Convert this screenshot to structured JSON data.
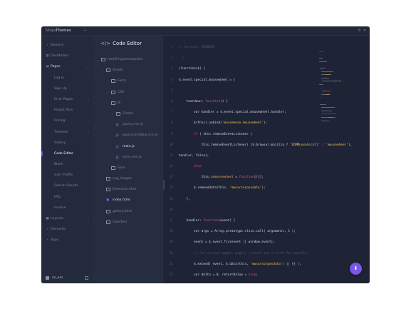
{
  "app": {
    "brand_left": "Ninja",
    "brand_right": "Themes"
  },
  "sidebar": {
    "items": [
      {
        "label": "General",
        "icon": "chevron-right-icon",
        "type": "section"
      },
      {
        "label": "Dashboard",
        "icon": "chart-icon",
        "chevron": "›"
      },
      {
        "label": "Pages",
        "icon": "document-icon",
        "chevron": "⌄",
        "bold": true
      },
      {
        "label": "Log In",
        "sub": true,
        "chevron": "›"
      },
      {
        "label": "Sign Up",
        "sub": true
      },
      {
        "label": "Error Pages",
        "sub": true,
        "chevron": "›"
      },
      {
        "label": "Forgot Pass",
        "sub": true
      },
      {
        "label": "Pricing",
        "sub": true,
        "chevron": "›"
      },
      {
        "label": "Timeline",
        "sub": true,
        "chevron": "›"
      },
      {
        "label": "Gallery",
        "sub": true
      },
      {
        "label": "Code Editor",
        "sub": true,
        "active": true
      },
      {
        "label": "Blank",
        "sub": true
      },
      {
        "label": "User Profile",
        "sub": true
      },
      {
        "label": "Search Results",
        "sub": true
      },
      {
        "label": "FAQ",
        "sub": true
      },
      {
        "label": "Invoice",
        "sub": true
      },
      {
        "label": "Layouts",
        "icon": "grid-icon",
        "chevron": "›"
      },
      {
        "label": "Elements",
        "icon": "chevron-right-icon",
        "type": "section"
      },
      {
        "label": "Apps",
        "icon": "chevron-right-icon",
        "type": "section"
      }
    ],
    "user": {
      "name": "an_ass"
    }
  },
  "explorer": {
    "title": "Code Editor",
    "tree": [
      {
        "name": "html5-hypertemplate",
        "depth": 0,
        "kind": "folder",
        "chev": "⌄"
      },
      {
        "name": "Assets",
        "depth": 1,
        "kind": "folder",
        "chev": "⌄"
      },
      {
        "name": "Fonts",
        "depth": 2,
        "kind": "folder",
        "chev": "›"
      },
      {
        "name": "CSS",
        "depth": 2,
        "kind": "folder",
        "chev": "›"
      },
      {
        "name": "JS",
        "depth": 2,
        "kind": "folder",
        "chev": "⌄"
      },
      {
        "name": "Charts",
        "depth": 3,
        "kind": "folder",
        "chev": "›"
      },
      {
        "name": "jquery.min.js",
        "depth": 3,
        "kind": "js"
      },
      {
        "name": "jquery.scrollbar.min.js",
        "depth": 3,
        "kind": "js"
      },
      {
        "name": "main.js",
        "depth": 3,
        "kind": "js",
        "active": true
      },
      {
        "name": "skins.min.js",
        "depth": 3,
        "kind": "js"
      },
      {
        "name": "Sass",
        "depth": 2,
        "kind": "folder",
        "chev": "›"
      },
      {
        "name": "svg_images",
        "depth": 1,
        "kind": "folder",
        "chev": "›"
      },
      {
        "name": "Elements.html",
        "depth": 1,
        "kind": "file"
      },
      {
        "name": "index.html",
        "depth": 1,
        "kind": "html",
        "active": true
      },
      {
        "name": "gallery.html",
        "depth": 1,
        "kind": "file"
      },
      {
        "name": "manifest",
        "depth": 1,
        "kind": "file"
      }
    ]
  },
  "editor": {
    "lines": [
      {
        "n": "1",
        "tokens": [
          {
            "t": "// Version: 3000006",
            "c": "comment"
          }
        ]
      },
      {
        "n": "2",
        "tokens": [
          {
            "t": "  \\",
            "c": "comment"
          }
        ]
      },
      {
        "n": "3",
        "tokens": [
          {
            "t": "(function($) {",
            "c": "plain"
          }
        ]
      },
      {
        "n": "4",
        "tokens": [
          {
            "t": "$.event.special.mousewheel = {",
            "c": "plain"
          }
        ]
      },
      {
        "n": "5",
        "tokens": [
          {
            "t": "",
            "c": "plain"
          }
        ]
      },
      {
        "n": "6",
        "tokens": [
          {
            "t": "    teardown: ",
            "c": "plain"
          },
          {
            "t": "function",
            "c": "kw"
          },
          {
            "t": "() {",
            "c": "plain"
          }
        ]
      },
      {
        "n": "7",
        "tokens": [
          {
            "t": "        var handler = $.event.special.mousewheel.handler;",
            "c": "plain"
          }
        ]
      },
      {
        "n": "8",
        "tokens": [
          {
            "t": "        $(this).unbind(",
            "c": "plain"
          },
          {
            "t": "'mousemove.mousewheel'",
            "c": "str"
          },
          {
            "t": ");",
            "c": "plain"
          }
        ]
      },
      {
        "n": "9",
        "tokens": [
          {
            "t": "        if",
            "c": "kw"
          },
          {
            "t": " ( this.removeEventListener )",
            "c": "plain"
          }
        ]
      },
      {
        "n": "10",
        "tokens": [
          {
            "t": "            this.removeEventListener( ($.browser.mozilla ? ",
            "c": "plain"
          },
          {
            "t": "'DOMMouseScroll'",
            "c": "str"
          },
          {
            "t": " : ",
            "c": "plain"
          },
          {
            "t": "'mousewheel'",
            "c": "str"
          },
          {
            "t": "),",
            "c": "plain"
          }
        ]
      },
      {
        "n": "11",
        "tokens": [
          {
            "t": "handler, false);",
            "c": "plain"
          }
        ]
      },
      {
        "n": "12",
        "tokens": [
          {
            "t": "        else",
            "c": "kw"
          }
        ]
      },
      {
        "n": "13",
        "tokens": [
          {
            "t": "            this.",
            "c": "plain"
          },
          {
            "t": "onmousewheel",
            "c": "fn"
          },
          {
            "t": " = ",
            "c": "plain"
          },
          {
            "t": "function",
            "c": "kw"
          },
          {
            "t": "(){};",
            "c": "plain"
          }
        ]
      },
      {
        "n": "14",
        "tokens": [
          {
            "t": "        $.removeData(this, ",
            "c": "plain"
          },
          {
            "t": "'mwcursorposdata'",
            "c": "str"
          },
          {
            "t": ");",
            "c": "plain"
          }
        ]
      },
      {
        "n": "15",
        "tokens": [
          {
            "t": "    },",
            "c": "plain"
          }
        ]
      },
      {
        "n": "16",
        "tokens": [
          {
            "t": "",
            "c": "plain"
          }
        ]
      },
      {
        "n": "17",
        "tokens": [
          {
            "t": "    handler: ",
            "c": "plain"
          },
          {
            "t": "function",
            "c": "kw"
          },
          {
            "t": "(event) {",
            "c": "plain"
          }
        ]
      },
      {
        "n": "18",
        "tokens": [
          {
            "t": "        var args = Array.prototype.slice.call( arguments, 1 );",
            "c": "plain"
          }
        ]
      },
      {
        "n": "19",
        "tokens": [
          {
            "t": "        event = $.event.fix(event || window.event);",
            "c": "plain"
          }
        ]
      },
      {
        "n": "20",
        "tokens": [
          {
            "t": "        // Get correct pageX, pageY, clientX and clientY for mozilla",
            "c": "comment"
          }
        ]
      },
      {
        "n": "21",
        "tokens": [
          {
            "t": "        $.extend( event, $.data(this, ",
            "c": "plain"
          },
          {
            "t": "'mwcursorposdata'",
            "c": "str"
          },
          {
            "t": ") || {} );",
            "c": "plain"
          }
        ]
      },
      {
        "n": "22",
        "tokens": [
          {
            "t": "        var delta = 0, returnValue = ",
            "c": "plain"
          },
          {
            "t": "true",
            "c": "kw"
          },
          {
            "t": ";",
            "c": "plain"
          }
        ]
      }
    ]
  },
  "colors": {
    "accent": "#7b57e8",
    "keyword": "#e6498f",
    "string": "#f2c14e",
    "function": "#f0a35a"
  },
  "fab": {
    "icon": "download-icon",
    "glyph": "⬇"
  }
}
